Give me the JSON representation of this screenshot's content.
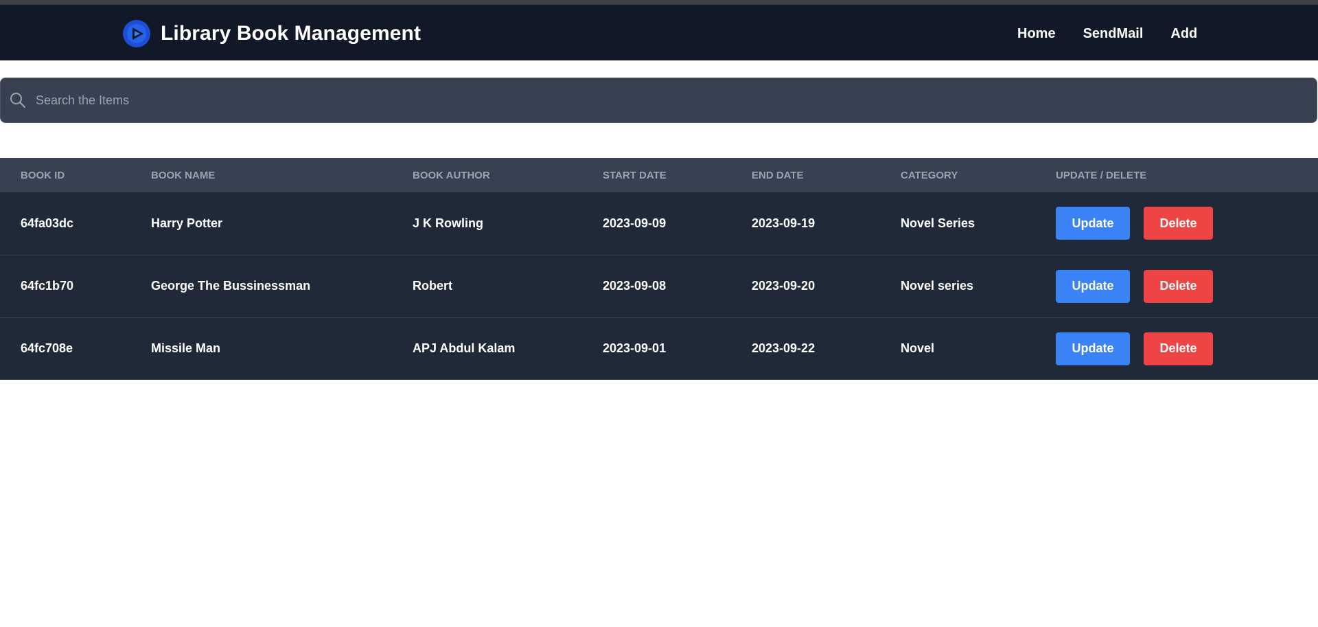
{
  "app": {
    "title": "Library Book Management",
    "accent_color": "#3b82f6",
    "logo_icon": "play-circle-logo"
  },
  "nav": {
    "items": [
      {
        "label": "Home"
      },
      {
        "label": "SendMail"
      },
      {
        "label": "Add"
      }
    ]
  },
  "search": {
    "placeholder": "Search the Items",
    "value": "",
    "icon": "search-icon"
  },
  "table": {
    "headers": [
      "Book ID",
      "Book Name",
      "Book Author",
      "Start Date",
      "End Date",
      "Category",
      "Update / Delete"
    ],
    "rows": [
      {
        "id": "64fa03dc",
        "name": "Harry Potter",
        "author": "J K Rowling",
        "start": "2023-09-09",
        "end": "2023-09-19",
        "category": "Novel Series"
      },
      {
        "id": "64fc1b70",
        "name": "George The Bussinessman",
        "author": "Robert",
        "start": "2023-09-08",
        "end": "2023-09-20",
        "category": "Novel series"
      },
      {
        "id": "64fc708e",
        "name": "Missile Man",
        "author": "APJ Abdul Kalam",
        "start": "2023-09-01",
        "end": "2023-09-22",
        "category": "Novel"
      }
    ],
    "update_label": "Update",
    "delete_label": "Delete",
    "update_color": "#3b82f6",
    "delete_color": "#ef4444"
  }
}
